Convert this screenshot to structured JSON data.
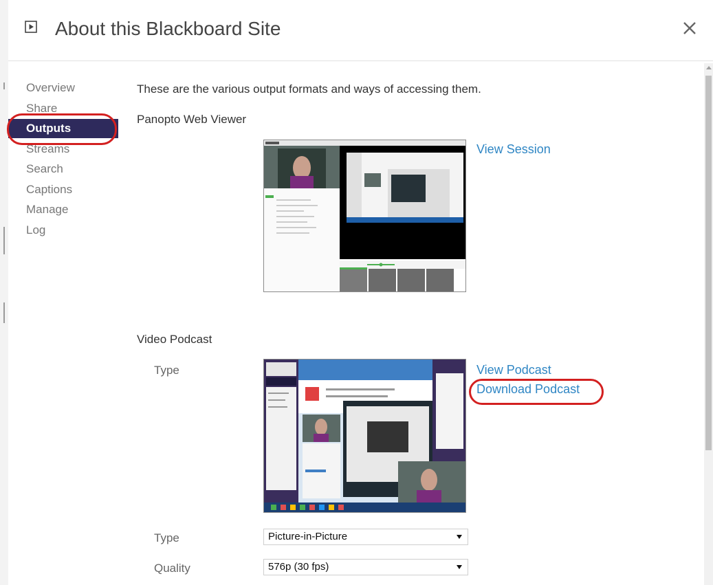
{
  "header": {
    "title": "About this Blackboard Site",
    "play_icon": "play-square-icon",
    "close_icon": "close-icon"
  },
  "nav": {
    "items": [
      {
        "label": "Overview",
        "active": false
      },
      {
        "label": "Share",
        "active": false
      },
      {
        "label": "Outputs",
        "active": true
      },
      {
        "label": "Streams",
        "active": false
      },
      {
        "label": "Search",
        "active": false
      },
      {
        "label": "Captions",
        "active": false
      },
      {
        "label": "Manage",
        "active": false
      },
      {
        "label": "Log",
        "active": false
      }
    ]
  },
  "main": {
    "intro": "These are the various output formats and ways of accessing them.",
    "web_viewer": {
      "title": "Panopto Web Viewer",
      "link": "View Session"
    },
    "podcast": {
      "title": "Video Podcast",
      "type_label": "Type",
      "view_link": "View Podcast",
      "download_link": "Download Podcast",
      "type_select_label": "Type",
      "type_value": "Picture-in-Picture",
      "quality_label": "Quality",
      "quality_value": "576p (30 fps)"
    }
  },
  "colors": {
    "nav_active_bg": "#2e2a5c",
    "link": "#2f86c4",
    "highlight_ring": "#d32020"
  }
}
